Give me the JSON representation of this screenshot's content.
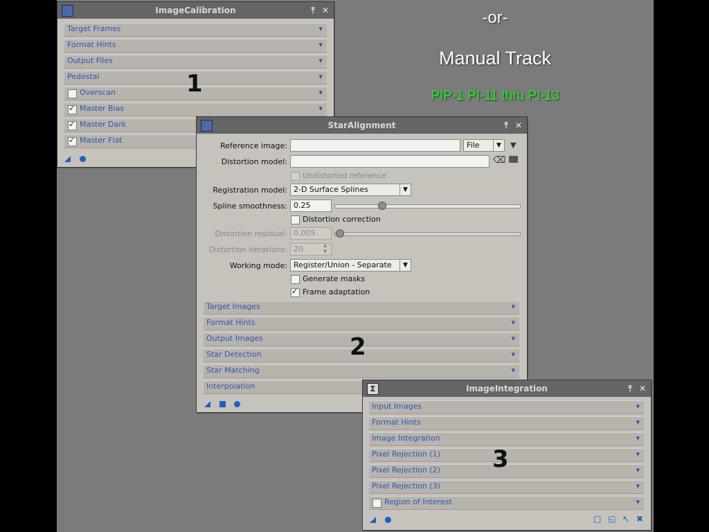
{
  "captions": {
    "or": "-or-",
    "manual_track": "Manual Track",
    "pip": "PIP-1 PI-11 thru PI-13"
  },
  "colors": {
    "accent": "#2c58b0",
    "pip_green": "#2fe62f",
    "panel_bg": "#c6c3bd",
    "title_bg": "#656565"
  },
  "calibration": {
    "title": "ImageCalibration",
    "number": "1",
    "sections": [
      {
        "label": "Target Frames"
      },
      {
        "label": "Format Hints"
      },
      {
        "label": "Output Files"
      },
      {
        "label": "Pedestal"
      },
      {
        "label": "Overscan",
        "checked": false
      },
      {
        "label": "Master Bias",
        "checked": true
      },
      {
        "label": "Master Dark",
        "checked": true
      },
      {
        "label": "Master Flat",
        "checked": true
      }
    ]
  },
  "alignment": {
    "title": "StarAlignment",
    "number": "2",
    "reference_image_label": "Reference image:",
    "reference_image_value": "",
    "reference_source": "File",
    "distortion_model_label": "Distortion model:",
    "distortion_model_value": "",
    "undistorted_reference": "Undistorted reference",
    "registration_model_label": "Registration model:",
    "registration_model_value": "2-D Surface Splines",
    "spline_smoothness_label": "Spline smoothness:",
    "spline_smoothness_value": "0.25",
    "distortion_correction": "Distortion correction",
    "distortion_residual_label": "Distortion residual:",
    "distortion_residual_value": "0.005",
    "distortion_iterations_label": "Distortion iterations:",
    "distortion_iterations_value": "20",
    "working_mode_label": "Working mode:",
    "working_mode_value": "Register/Union - Separate",
    "generate_masks": "Generate masks",
    "frame_adaptation": "Frame adaptation",
    "sections": [
      {
        "label": "Target Images"
      },
      {
        "label": "Format Hints"
      },
      {
        "label": "Output Images"
      },
      {
        "label": "Star Detection"
      },
      {
        "label": "Star Matching"
      },
      {
        "label": "Interpolation"
      }
    ]
  },
  "integration": {
    "title": "ImageIntegration",
    "number": "3",
    "sections": [
      {
        "label": "Input Images"
      },
      {
        "label": "Format Hints"
      },
      {
        "label": "Image Integration"
      },
      {
        "label": "Pixel Rejection (1)"
      },
      {
        "label": "Pixel Rejection (2)"
      },
      {
        "label": "Pixel Rejection (3)"
      },
      {
        "label": "Region of Interest",
        "checked": false
      }
    ]
  }
}
